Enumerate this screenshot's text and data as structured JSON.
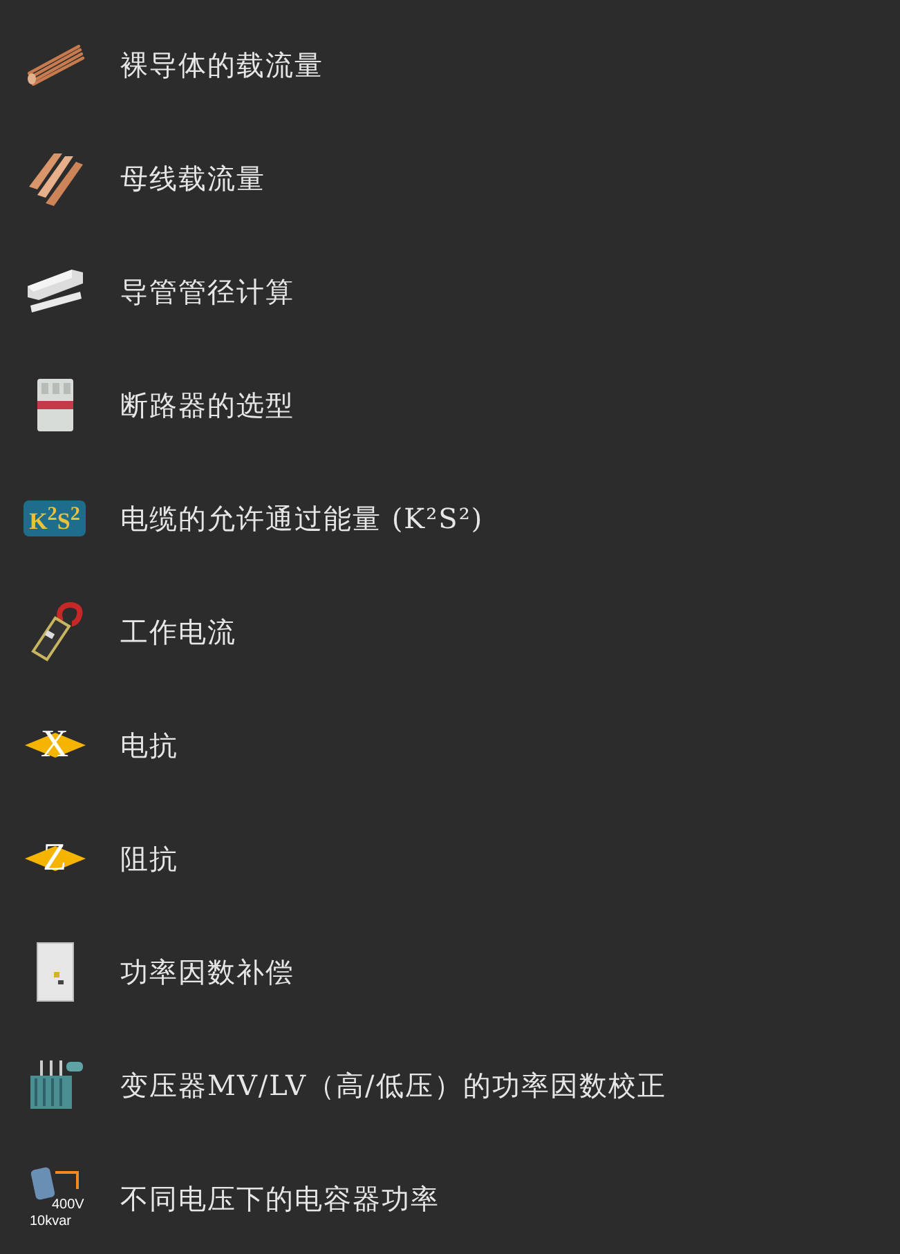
{
  "items": [
    {
      "label": "裸导体的载流量",
      "kind": "wire"
    },
    {
      "label": "母线载流量",
      "kind": "busbar"
    },
    {
      "label": "导管管径计算",
      "kind": "conduit"
    },
    {
      "label": "断路器的选型",
      "kind": "breaker"
    },
    {
      "label": "电缆的允许通过能量 (K²S²)",
      "kind": "k2s2",
      "icon_text": "K$^{2}$S$^{2}$"
    },
    {
      "label": "工作电流",
      "kind": "clamp"
    },
    {
      "label": "电抗",
      "kind": "letter",
      "icon_text": "X"
    },
    {
      "label": "阻抗",
      "kind": "letter",
      "icon_text": "Z"
    },
    {
      "label": "功率因数补偿",
      "kind": "cabinet"
    },
    {
      "label": "变压器MV/LV（高/低压）的功率因数校正",
      "kind": "transformer"
    },
    {
      "label": "不同电压下的电容器功率",
      "kind": "capacitor",
      "icon_lines": [
        "400V",
        "10kvar"
      ]
    }
  ]
}
